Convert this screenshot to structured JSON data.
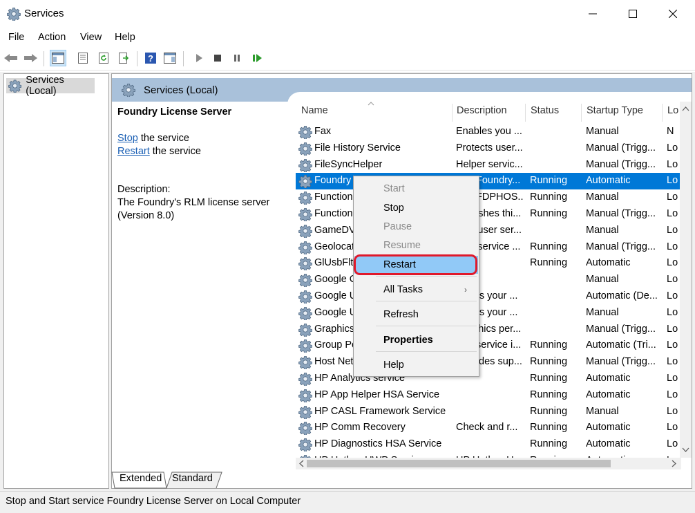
{
  "window": {
    "title": "Services",
    "app_icon": "gear-icon",
    "buttons": [
      "minimize-icon",
      "maximize-icon",
      "close-icon"
    ]
  },
  "menu": [
    "File",
    "Action",
    "View",
    "Help"
  ],
  "toolbar": {
    "icons": [
      "back-arrow-icon",
      "forward-arrow-icon",
      "show-hide-console-tree-icon",
      "properties-icon",
      "refresh-icon",
      "export-list-icon",
      "help-icon",
      "show-hide-action-pane-icon",
      "play-icon",
      "stop-icon",
      "pause-icon",
      "resume-icon"
    ]
  },
  "tree": {
    "item": "Services (Local)"
  },
  "panel": {
    "header": "Services (Local)",
    "service_name": "Foundry License Server",
    "stop_link": "Stop",
    "stop_rest": " the service",
    "restart_link": "Restart",
    "restart_rest": " the service",
    "description_label": "Description:",
    "description_line1": "The Foundry's RLM license server",
    "description_line2": "(Version 8.0)"
  },
  "table": {
    "columns": [
      "Name",
      "Description",
      "Status",
      "Startup Type",
      "Lo"
    ],
    "rows": [
      [
        "Fax",
        "Enables you ...",
        "",
        "Manual",
        "N"
      ],
      [
        "File History Service",
        "Protects user...",
        "",
        "Manual (Trigg...",
        "Lo"
      ],
      [
        "FileSyncHelper",
        "Helper servic...",
        "",
        "Manual (Trigg...",
        "Lo"
      ],
      [
        "Foundry License Server",
        "The Foundry...",
        "Running",
        "Automatic",
        "Lo"
      ],
      [
        "Function Discovery Provider Host",
        "The FDPHOS...",
        "Running",
        "Manual",
        "Lo"
      ],
      [
        "Function Discovery Resource Publication",
        "Publishes thi...",
        "Running",
        "Manual (Trigg...",
        "Lo"
      ],
      [
        "GameDVR and Broadcast User Service",
        "This user ser...",
        "",
        "Manual",
        "Lo"
      ],
      [
        "Geolocation Service",
        "This service ...",
        "Running",
        "Manual (Trigg...",
        "Lo"
      ],
      [
        "GlUsbFltService",
        "",
        "Running",
        "Automatic",
        "Lo"
      ],
      [
        "Google Chrome Elevation Service",
        "",
        "",
        "Manual",
        "Lo"
      ],
      [
        "Google Update Service (gupdate)",
        "Keeps your ...",
        "",
        "Automatic (De...",
        "Lo"
      ],
      [
        "Google Update Service (gupdatem)",
        "Keeps your ...",
        "",
        "Manual",
        "Lo"
      ],
      [
        "Graphics performance monitor service",
        "Graphics per...",
        "",
        "Manual (Trigg...",
        "Lo"
      ],
      [
        "Group Policy Client",
        "The service i...",
        "Running",
        "Automatic (Tri...",
        "Lo"
      ],
      [
        "Host Network Service",
        "Provides sup...",
        "Running",
        "Manual (Trigg...",
        "Lo"
      ],
      [
        "HP Analytics service",
        "",
        "Running",
        "Automatic",
        "Lo"
      ],
      [
        "HP App Helper HSA Service",
        "",
        "Running",
        "Automatic",
        "Lo"
      ],
      [
        "HP CASL Framework Service",
        "",
        "Running",
        "Manual",
        "Lo"
      ],
      [
        "HP Comm Recovery",
        "Check and r...",
        "Running",
        "Automatic",
        "Lo"
      ],
      [
        "HP Diagnostics HSA Service",
        "",
        "Running",
        "Automatic",
        "Lo"
      ],
      [
        "HP Hotkey UWP Service",
        "HP Hotkey U...",
        "Running",
        "Automatic",
        "Lo"
      ]
    ]
  },
  "context_menu": {
    "items": [
      {
        "label": "Start",
        "state": "disabled"
      },
      {
        "label": "Stop",
        "state": "enabled"
      },
      {
        "label": "Pause",
        "state": "disabled"
      },
      {
        "label": "Resume",
        "state": "disabled"
      },
      {
        "label": "Restart",
        "state": "highlighted"
      },
      {
        "label": "All Tasks",
        "state": "submenu"
      },
      {
        "label": "Refresh",
        "state": "enabled"
      },
      {
        "label": "Properties",
        "state": "bold"
      },
      {
        "label": "Help",
        "state": "enabled"
      }
    ],
    "submenu_arrow": "›"
  },
  "tabs": [
    "Extended",
    "Standard"
  ],
  "status_bar": "Stop and Start service Foundry License Server on Local Computer",
  "colors": {
    "selection": "#0078d7",
    "header_band": "#a9c1da",
    "menu_highlight": "#91c9f7",
    "annotation_ring": "#e0192b",
    "link": "#1a5fb4"
  }
}
